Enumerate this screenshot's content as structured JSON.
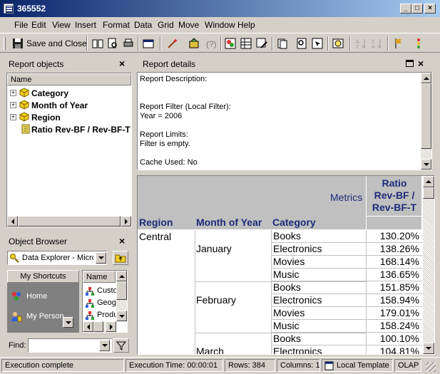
{
  "window": {
    "title": "365552"
  },
  "menu": [
    "File",
    "Edit",
    "View",
    "Insert",
    "Format",
    "Data",
    "Grid",
    "Move",
    "Window",
    "Help"
  ],
  "toolbar": {
    "save_label": "Save and Close"
  },
  "report_objects": {
    "title": "Report objects",
    "column_header": "Name",
    "items": [
      {
        "label": "Category",
        "icon": "attribute-cube-icon"
      },
      {
        "label": "Month of Year",
        "icon": "attribute-cube-icon"
      },
      {
        "label": "Region",
        "icon": "attribute-cube-icon"
      },
      {
        "label": "Ratio Rev-BF / Rev-BF-T",
        "icon": "metric-icon"
      }
    ]
  },
  "object_browser": {
    "title": "Object Browser",
    "explorer_value": "Data Explorer - Micro",
    "shortcuts_header": "My Shortcuts",
    "shortcuts": [
      "Home",
      "My Person"
    ],
    "list_header": "Name",
    "list_items": [
      "Custo",
      "Geogr",
      "Produ"
    ],
    "find_label": "Find:",
    "find_value": ""
  },
  "report_details": {
    "title": "Report details",
    "lines": [
      "Report Description:",
      "",
      "",
      "Report Filter (Local Filter):",
      "Year = 2006",
      "",
      "Report Limits:",
      "Filter is empty.",
      "",
      "Cache Used: No"
    ]
  },
  "grid": {
    "metrics_label": "Metrics",
    "metric_header": "Ratio Rev-BF / Rev-BF-T",
    "metric_header_lines": [
      "Ratio",
      "Rev-BF /",
      "Rev-BF-T"
    ],
    "col_headers": [
      "Region",
      "Month of Year",
      "Category"
    ],
    "region": "Central",
    "months": [
      "January",
      "February",
      "March"
    ],
    "rows": [
      {
        "category": "Books",
        "value": "130.20%"
      },
      {
        "category": "Electronics",
        "value": "138.26%"
      },
      {
        "category": "Movies",
        "value": "168.14%"
      },
      {
        "category": "Music",
        "value": "136.65%"
      },
      {
        "category": "Books",
        "value": "151.85%"
      },
      {
        "category": "Electronics",
        "value": "158.94%"
      },
      {
        "category": "Movies",
        "value": "179.01%"
      },
      {
        "category": "Music",
        "value": "158.24%"
      },
      {
        "category": "Books",
        "value": "100.10%"
      },
      {
        "category": "Electronics",
        "value": "104.81%"
      }
    ]
  },
  "status": {
    "message": "Execution complete",
    "time": "Execution Time: 00:00:01",
    "rows": "Rows: 384",
    "columns": "Columns: 1",
    "template": "Local Template",
    "mode": "OLAP"
  }
}
